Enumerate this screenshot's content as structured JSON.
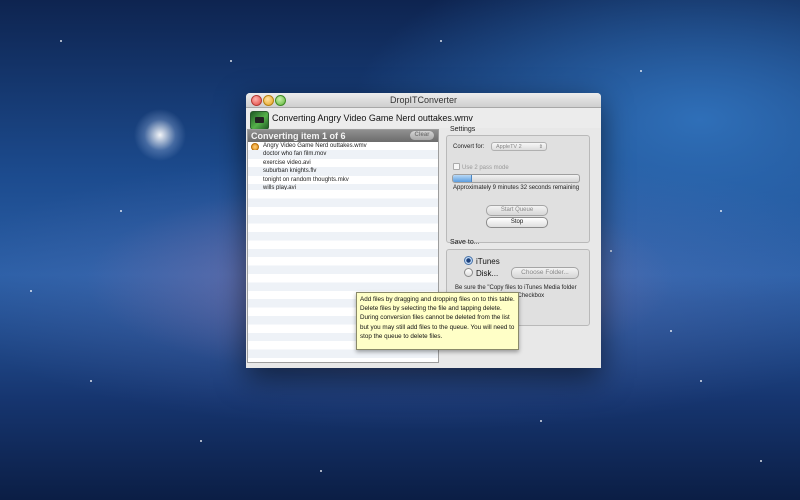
{
  "window": {
    "title": "DropITConverter",
    "converting_title": "Converting Angry Video Game Nerd outtakes.wmv"
  },
  "queue": {
    "header": "Converting item 1 of 6",
    "clear_label": "Clear",
    "items": [
      "Angry Video Game Nerd outtakes.wmv",
      "doctor who fan film.mov",
      "exercise video.avi",
      "suburban knights.flv",
      "tonight on random thoughts.mkv",
      "wills play.avi"
    ]
  },
  "settings": {
    "section_label": "Settings",
    "convert_for_label": "Convert for:",
    "convert_for_value": "AppleTV 2",
    "two_pass_label": "Use 2 pass mode",
    "two_pass_checked": false,
    "progress_fraction": 0.14,
    "remaining_text": "Approximately 9 minutes 32 seconds remaining",
    "start_queue_label": "Start Queue",
    "stop_label": "Stop"
  },
  "save_to": {
    "section_label": "Save to...",
    "itunes_label": "iTunes",
    "disk_label": "Disk...",
    "choose_folder_label": "Choose Folder...",
    "selected": "iTunes",
    "note": "Be sure the \"Copy files to iTunes Media folder when adding to library\" Checkbox"
  },
  "tooltip": {
    "text": "Add files by dragging and dropping files on to this table.  Delete files by selecting the file and tapping delete.  During conversion files cannot be deleted from the list but you may still add files to the queue. You will need to stop the queue to delete files."
  },
  "colors": {
    "progress_fill": "#5c9ee0",
    "tooltip_bg": "#ffffc7",
    "queue_header_bg": "#7c7c7c"
  }
}
